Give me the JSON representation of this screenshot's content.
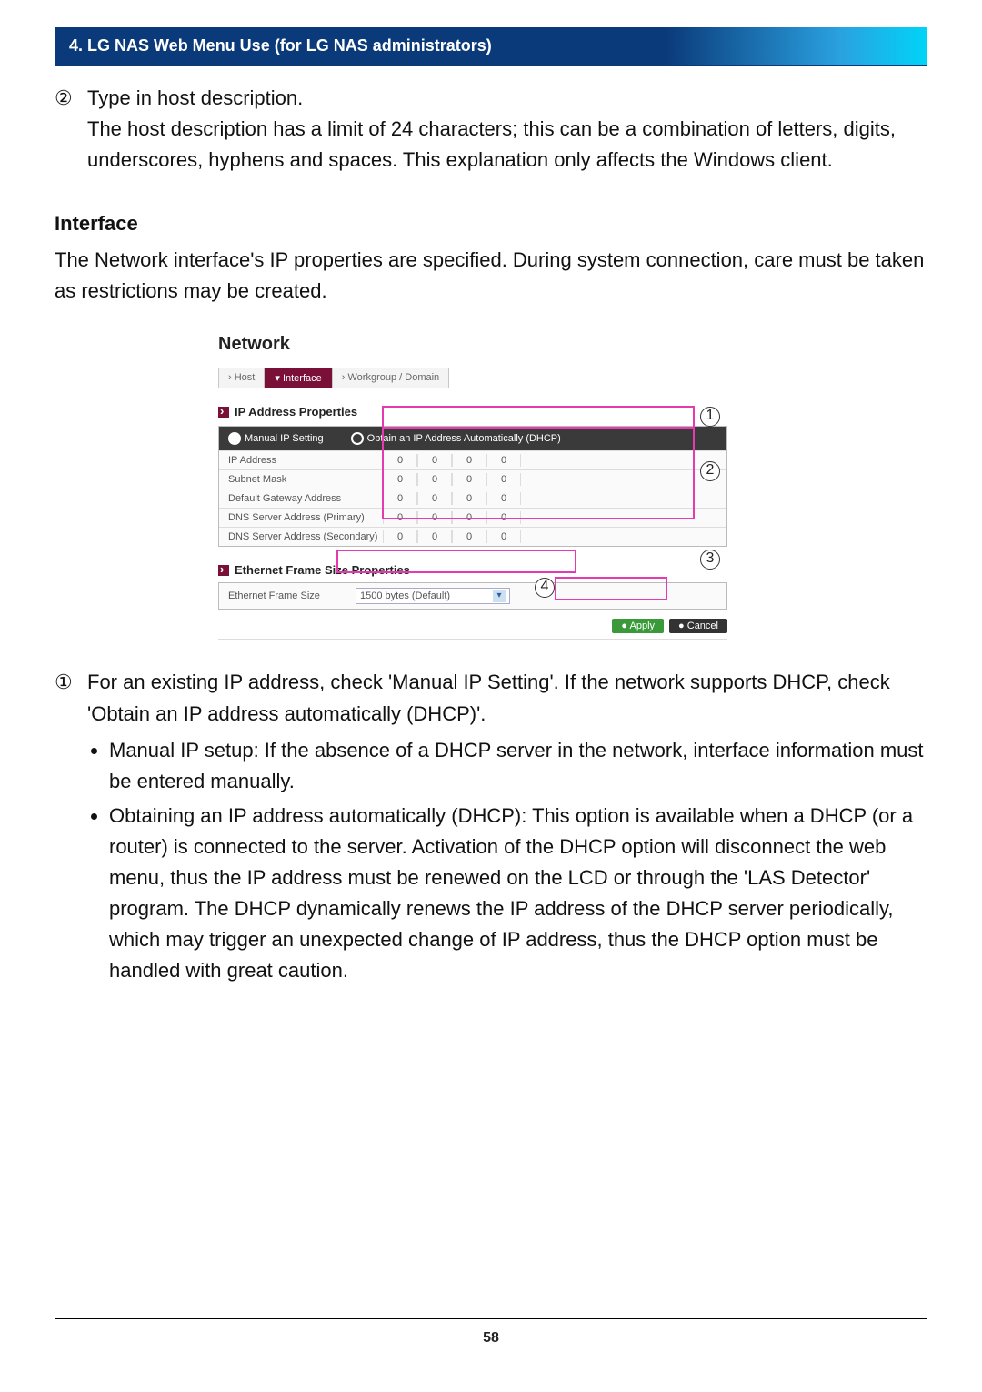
{
  "header": "4. LG NAS Web Menu Use (for LG NAS administrators)",
  "step2": {
    "marker": "②",
    "line1": "Type in host description.",
    "line2": "The host description has a limit of 24 characters; this can be a combination of letters, digits, underscores, hyphens and spaces. This explanation only affects the Windows client."
  },
  "interface": {
    "heading": "Interface",
    "para": "The Network interface's IP properties are specified. During system connection, care must be taken as restrictions may be created."
  },
  "screenshot": {
    "title": "Network",
    "tabs": {
      "host": "Host",
      "interface": "Interface",
      "workgroup": "Workgroup / Domain"
    },
    "ip_section_label": "IP Address Properties",
    "radio_manual": "Manual IP Setting",
    "radio_dhcp": "Obtain an IP Address Automatically (DHCP)",
    "rows": {
      "ip": "IP Address",
      "subnet": "Subnet Mask",
      "gateway": "Default Gateway Address",
      "dns1": "DNS Server Address (Primary)",
      "dns2": "DNS Server Address (Secondary)"
    },
    "cell_value": "0",
    "eth_section_label": "Ethernet Frame Size Properties",
    "eth_row_label": "Ethernet Frame Size",
    "eth_select_value": "1500 bytes (Default)",
    "apply": "Apply",
    "cancel": "Cancel",
    "callouts": {
      "c1": "1",
      "c2": "2",
      "c3": "3",
      "c4": "4"
    }
  },
  "notes": {
    "n1_marker": "①",
    "n1_text": "For an existing IP address, check 'Manual IP Setting'. If the network supports DHCP, check 'Obtain an IP address automatically (DHCP)'.",
    "bullet1": "Manual IP setup: If the absence of a DHCP server in the network, interface information must be entered manually.",
    "bullet2": "Obtaining an IP address automatically (DHCP): This option is available when a DHCP (or a router) is connected to the server. Activation of the DHCP option will disconnect the web menu, thus the IP address must be renewed on the LCD or through the 'LAS Detector' program. The DHCP dynamically renews the IP address of the DHCP server periodically, which may trigger an unexpected change of IP address, thus the DHCP option must be handled with great caution."
  },
  "page_number": "58"
}
